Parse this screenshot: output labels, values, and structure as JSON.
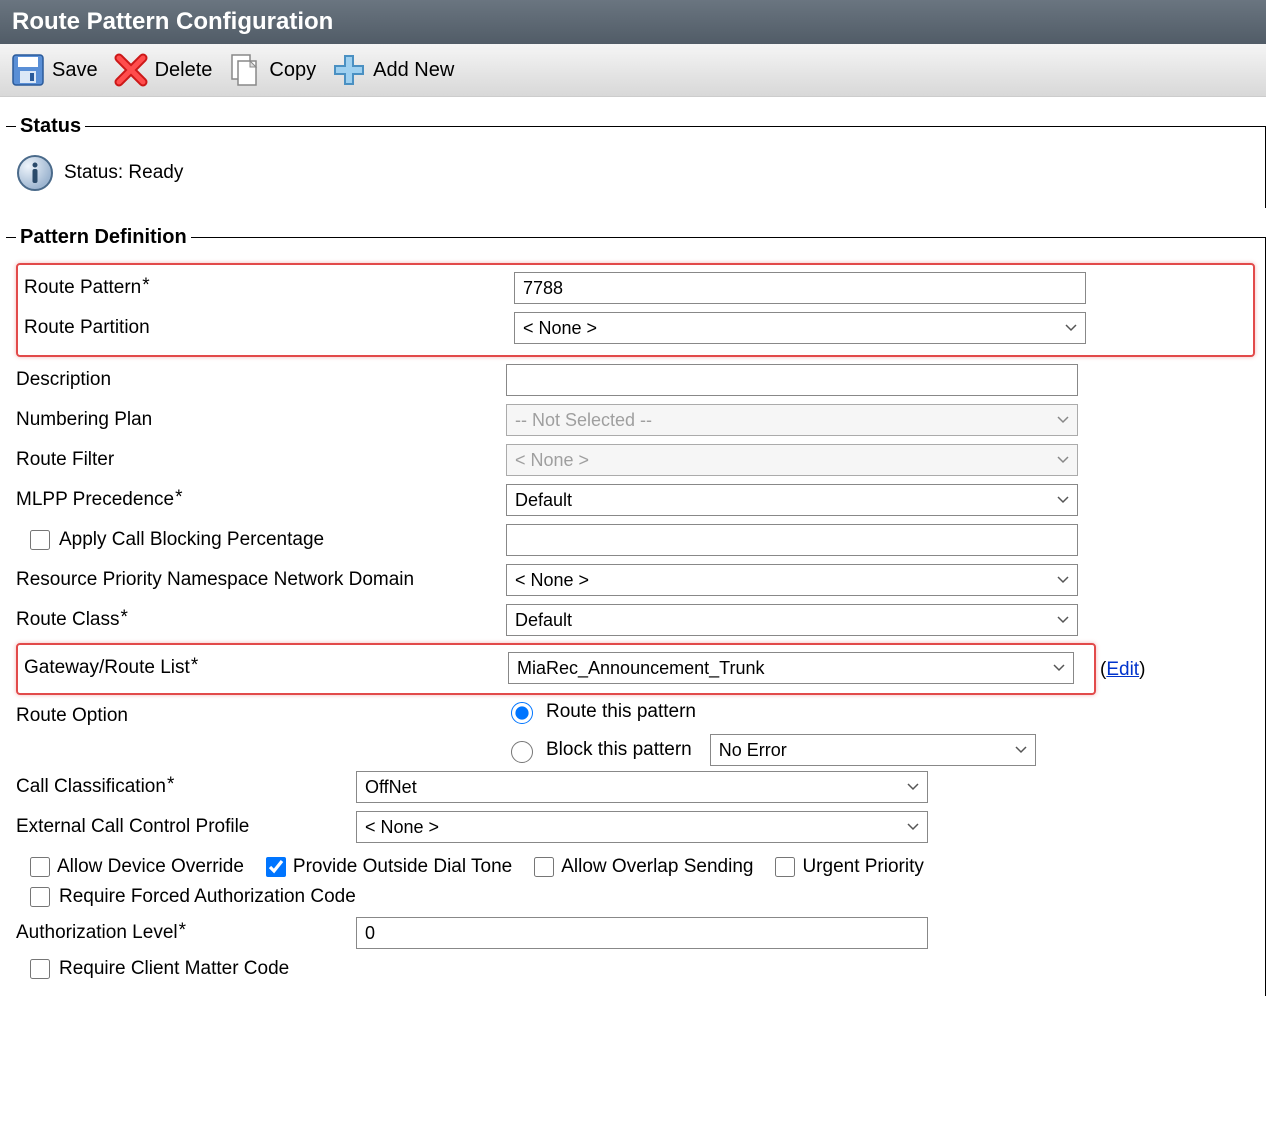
{
  "header": {
    "title": "Route Pattern Configuration"
  },
  "toolbar": {
    "save": "Save",
    "delete": "Delete",
    "copy": "Copy",
    "addnew": "Add New"
  },
  "status": {
    "legend": "Status",
    "text": "Status: Ready"
  },
  "pattern": {
    "legend": "Pattern Definition",
    "route_pattern_label": "Route Pattern",
    "route_pattern_value": "7788",
    "route_partition_label": "Route Partition",
    "route_partition_value": "< None >",
    "description_label": "Description",
    "description_value": "",
    "numbering_plan_label": "Numbering Plan",
    "numbering_plan_value": "-- Not Selected --",
    "route_filter_label": "Route Filter",
    "route_filter_value": "< None >",
    "mlpp_label": "MLPP Precedence",
    "mlpp_value": "Default",
    "apply_call_blocking_label": "Apply Call Blocking Percentage",
    "rpnnd_label": "Resource Priority Namespace Network Domain",
    "rpnnd_value": "< None >",
    "route_class_label": "Route Class",
    "route_class_value": "Default",
    "gateway_label": "Gateway/Route List",
    "gateway_value": "MiaRec_Announcement_Trunk",
    "edit_link": "Edit",
    "route_option_label": "Route Option",
    "route_option_route": "Route this pattern",
    "route_option_block": "Block this pattern",
    "block_select_value": "No Error",
    "call_classification_label": "Call Classification",
    "call_classification_value": "OffNet",
    "eccp_label": "External Call Control Profile",
    "eccp_value": "< None >",
    "chk_allow_device_override": "Allow Device Override",
    "chk_provide_outside": "Provide Outside Dial Tone",
    "chk_allow_overlap": "Allow Overlap Sending",
    "chk_urgent": "Urgent Priority",
    "chk_require_fac": "Require Forced Authorization Code",
    "auth_level_label": "Authorization Level",
    "auth_level_value": "0",
    "chk_require_cmc": "Require Client Matter Code"
  }
}
